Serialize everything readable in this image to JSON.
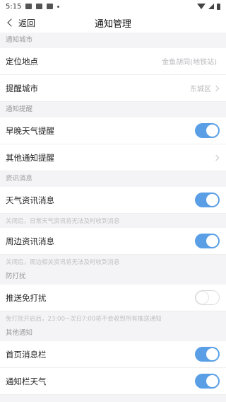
{
  "status": {
    "time": "5:15"
  },
  "nav": {
    "back_label": "返回",
    "title": "通知管理"
  },
  "sections": {
    "city": "通知城市",
    "reminder": "通知提醒",
    "news": "资讯消息",
    "dnd": "防打扰",
    "other": "其他通知"
  },
  "rows": {
    "location": {
      "label": "定位地点",
      "value": "金鱼胡同(地铁站)"
    },
    "reminder_city": {
      "label": "提醒城市",
      "value": "东城区"
    },
    "morning_evening": {
      "label": "早晚天气提醒",
      "on": true
    },
    "other_reminder": {
      "label": "其他通知提醒"
    },
    "weather_news": {
      "label": "天气资讯消息",
      "on": true
    },
    "nearby_news": {
      "label": "周边资讯消息",
      "on": true
    },
    "push_dnd": {
      "label": "推送免打扰",
      "on": false
    },
    "home_bar": {
      "label": "首页消息栏",
      "on": true
    },
    "notif_weather": {
      "label": "通知栏天气",
      "on": true
    }
  },
  "notes": {
    "weather_news": "关闭后，日常天气资讯将无法及时收到消息",
    "nearby_news": "关闭后，周边相关资讯将无法及时收到消息",
    "dnd": "免打扰开启后，23:00~次日7:00将不会收到所有推送通知"
  },
  "colors": {
    "toggle_on": "#5a9fe6",
    "background": "#f4f4f6"
  }
}
